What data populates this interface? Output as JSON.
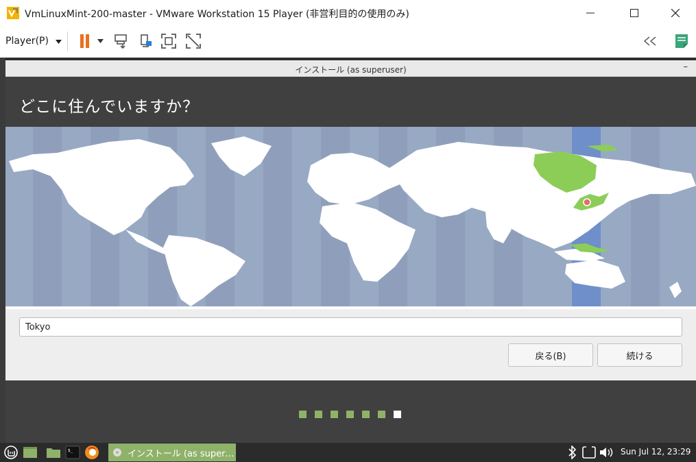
{
  "window": {
    "title": "VmLinuxMint-200-master - VMware Workstation 15 Player (非営利目的の使用のみ)",
    "icons": [
      "vmware-logo-icon",
      "minimize-icon",
      "maximize-icon",
      "close-icon"
    ]
  },
  "toolbar": {
    "player_menu": "Player(P)",
    "icons": [
      "pause-icon",
      "send-ctrl-alt-del-icon",
      "removable-devices-icon",
      "fullscreen-icon",
      "unity-icon",
      "library-collapse-icon",
      "notes-icon"
    ]
  },
  "installer": {
    "window_title": "インストール (as superuser)",
    "minimize_glyph": "–",
    "heading": "どこに住んでいますか？",
    "location_value": "Tokyo",
    "back_label": "戻る(B)",
    "continue_label": "続ける",
    "progress": {
      "total_steps": 7,
      "current_step": 7
    }
  },
  "taskbar": {
    "task_label": "インストール (as super…",
    "clock": "Sun Jul 12, 23:29",
    "icons": [
      "mint-menu-icon",
      "show-desktop-icon",
      "files-icon",
      "terminal-icon",
      "firefox-icon",
      "bluetooth-icon",
      "network-icon",
      "volume-icon"
    ]
  },
  "colors": {
    "accent_green": "#8fb26a",
    "map_ocean": "#98a9c4",
    "timezone_band": "#6e8fca",
    "highlight_land": "#8ccd58",
    "pause_orange": "#e8711e",
    "installer_dark": "#404040"
  }
}
